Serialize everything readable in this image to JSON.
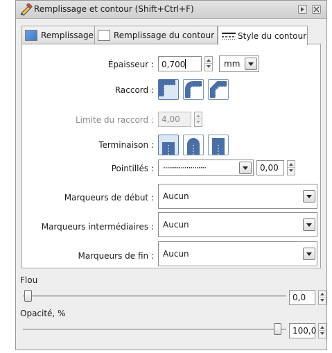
{
  "window": {
    "title": "Remplissage et contour (Shift+Ctrl+F)"
  },
  "tabs": [
    {
      "label": "Remplissage",
      "active": false
    },
    {
      "label": "Remplissage du contour",
      "active": false
    },
    {
      "label": "Style du contour",
      "active": true
    }
  ],
  "stroke": {
    "width_label": "Épaisseur :",
    "width_value": "0,700",
    "unit": "mm",
    "join_label": "Raccord :",
    "join_selected": "miter",
    "miter_label": "Limite du raccord :",
    "miter_value": "4,00",
    "cap_label": "Terminaison :",
    "cap_selected": "butt",
    "dashes_label": "Pointillés :",
    "dash_pattern": "······················",
    "dash_offset": "0,00",
    "start_markers_label": "Marqueurs de début :",
    "start_markers_value": "Aucun",
    "mid_markers_label": "Marqueurs intermédiaires :",
    "mid_markers_value": "Aucun",
    "end_markers_label": "Marqueurs de fin :",
    "end_markers_value": "Aucun"
  },
  "blur": {
    "label": "Flou",
    "value": "0,0",
    "level": 0
  },
  "opacity": {
    "label": "Opacité, %",
    "value": "100,0",
    "level": 1
  },
  "colors": {
    "accent": "#5b7fae",
    "selected_bg": "#dbe7f6"
  }
}
